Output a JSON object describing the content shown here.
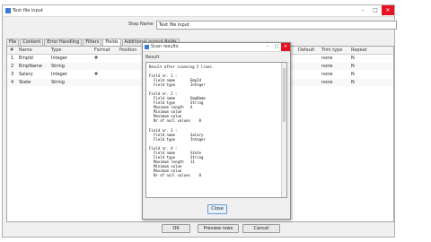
{
  "window": {
    "title": "Text file input",
    "ctrl_min": "–",
    "ctrl_max": "□",
    "ctrl_close": "✕"
  },
  "step": {
    "label": "Step Name",
    "value": "Text file input"
  },
  "tabs": [
    "File",
    "Content",
    "Error Handling",
    "Filters",
    "Fields",
    "Additional output fields"
  ],
  "table": {
    "headers": [
      "#",
      "Name",
      "Type",
      "Format",
      "Position",
      "Default",
      "Trim type",
      "Repeat"
    ],
    "rows": [
      {
        "num": "1",
        "name": "EmpId",
        "type": "Integer",
        "format": "#",
        "trim": "none",
        "repeat": "N"
      },
      {
        "num": "2",
        "name": "EmpName",
        "type": "String",
        "format": "",
        "trim": "none",
        "repeat": "N"
      },
      {
        "num": "3",
        "name": "Salary",
        "type": "Integer",
        "format": "#",
        "trim": "none",
        "repeat": "N"
      },
      {
        "num": "4",
        "name": "State",
        "type": "String",
        "format": "",
        "trim": "none",
        "repeat": "N"
      }
    ]
  },
  "buttons": {
    "ok": "OK",
    "preview": "Preview rows",
    "cancel": "Cancel"
  },
  "dialog": {
    "title": "Scan results",
    "ctrl_min": "–",
    "ctrl_max": "□",
    "ctrl_close": "✕",
    "result_label": "Result",
    "summary": "Result after scanning 5 lines.",
    "fields": [
      {
        "header": "Field nr. 1 :",
        "lines": [
          "Field name       EmpId",
          "Field type       Integer"
        ]
      },
      {
        "header": "Field nr. 2 :",
        "lines": [
          "Field name       EmpName",
          "Field type       String",
          "Maximum length   4",
          "Minimum value",
          "Maximum value",
          "Nr of null values    0"
        ]
      },
      {
        "header": "Field nr. 3 :",
        "lines": [
          "Field name       Salary",
          "Field type       Integer"
        ]
      },
      {
        "header": "Field nr. 4 :",
        "lines": [
          "Field name       State",
          "Field type       String",
          "Maximum length   11",
          "Minimum value",
          "Maximum value",
          "Nr of null values    0"
        ]
      }
    ],
    "close_label": "Close"
  }
}
